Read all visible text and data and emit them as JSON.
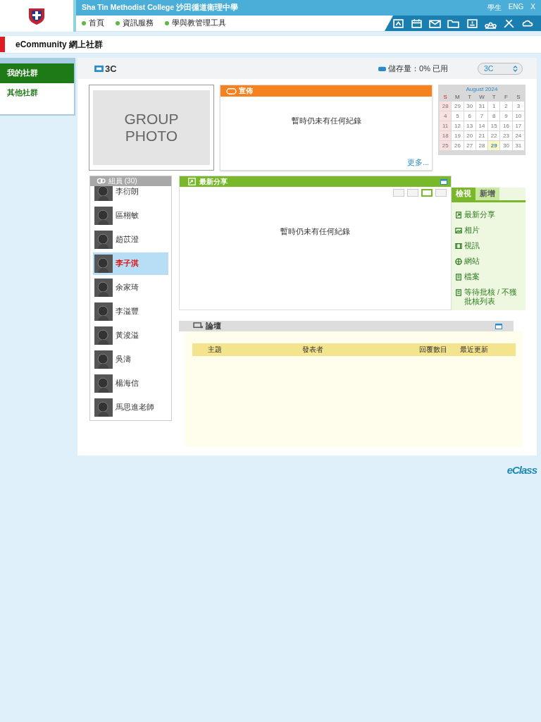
{
  "header": {
    "school": "Sha Tin Methodist College 沙田循道衛理中學",
    "links": [
      "學生",
      "ENG",
      "X"
    ],
    "nav": [
      "首頁",
      "資訊服務",
      "學與教管理工具"
    ]
  },
  "page_title": "eCommunity 網上社群",
  "sidebar": {
    "items": [
      {
        "label": "我的社群",
        "selected": true
      },
      {
        "label": "其他社群",
        "selected": false
      }
    ]
  },
  "group": {
    "name": "3C",
    "storage": "儲存量：0% 已用",
    "selector": "3C",
    "photo_lines": [
      "GROUP",
      "PHOTO"
    ]
  },
  "announcement": {
    "title": "宣佈",
    "empty": "暫時仍未有任何紀錄",
    "more": "更多..."
  },
  "calendar": {
    "title": "August 2024",
    "weekdays": [
      "S",
      "M",
      "T",
      "W",
      "T",
      "F",
      "S"
    ],
    "weeks": [
      [
        {
          "day": "28",
          "today": false
        },
        {
          "day": "29",
          "today": false
        },
        {
          "day": "30",
          "today": false
        },
        {
          "day": "31",
          "today": false
        },
        {
          "day": "1",
          "today": false
        },
        {
          "day": "2",
          "today": false
        },
        {
          "day": "3",
          "today": false
        }
      ],
      [
        {
          "day": "4",
          "today": false
        },
        {
          "day": "5",
          "today": false
        },
        {
          "day": "6",
          "today": false
        },
        {
          "day": "7",
          "today": false
        },
        {
          "day": "8",
          "today": false
        },
        {
          "day": "9",
          "today": false
        },
        {
          "day": "10",
          "today": false
        }
      ],
      [
        {
          "day": "11",
          "today": false
        },
        {
          "day": "12",
          "today": false
        },
        {
          "day": "13",
          "today": false
        },
        {
          "day": "14",
          "today": false
        },
        {
          "day": "15",
          "today": false
        },
        {
          "day": "16",
          "today": false
        },
        {
          "day": "17",
          "today": false
        }
      ],
      [
        {
          "day": "18",
          "today": false
        },
        {
          "day": "19",
          "today": false
        },
        {
          "day": "20",
          "today": false
        },
        {
          "day": "21",
          "today": false
        },
        {
          "day": "22",
          "today": false
        },
        {
          "day": "23",
          "today": false
        },
        {
          "day": "24",
          "today": false
        }
      ],
      [
        {
          "day": "25",
          "today": false
        },
        {
          "day": "26",
          "today": false
        },
        {
          "day": "27",
          "today": false
        },
        {
          "day": "28",
          "today": false
        },
        {
          "day": "29",
          "today": true
        },
        {
          "day": "30",
          "today": false
        },
        {
          "day": "31",
          "today": false
        }
      ]
    ]
  },
  "members": {
    "title": "組員 (30)",
    "items": [
      {
        "name": "李衍朗",
        "selected": false
      },
      {
        "name": "區栩敏",
        "selected": false
      },
      {
        "name": "趙苡澄",
        "selected": false
      },
      {
        "name": "李子淇",
        "selected": true
      },
      {
        "name": "余家琦",
        "selected": false
      },
      {
        "name": "李溢豐",
        "selected": false
      },
      {
        "name": "黃浚溢",
        "selected": false
      },
      {
        "name": "吳濤",
        "selected": false
      },
      {
        "name": "楊海信",
        "selected": false
      },
      {
        "name": "馬思進老師",
        "selected": false
      }
    ]
  },
  "sharing": {
    "title": "最新分享",
    "empty": "暫時仍未有任何紀錄",
    "view_modes": [
      {
        "selected": false
      },
      {
        "selected": false
      },
      {
        "selected": true
      },
      {
        "selected": false
      }
    ],
    "tabs": [
      {
        "label": "檢視",
        "selected": true
      },
      {
        "label": "新增",
        "selected": false
      }
    ],
    "menu": [
      "最新分享",
      "相片",
      "視訊",
      "網站",
      "檔案",
      "等待批核 / 不獲批核列表"
    ]
  },
  "forum": {
    "title": "論壇",
    "columns": [
      "主題",
      "發表者",
      "回覆數目",
      "最近更新"
    ]
  },
  "footer_logo": "eClass"
}
